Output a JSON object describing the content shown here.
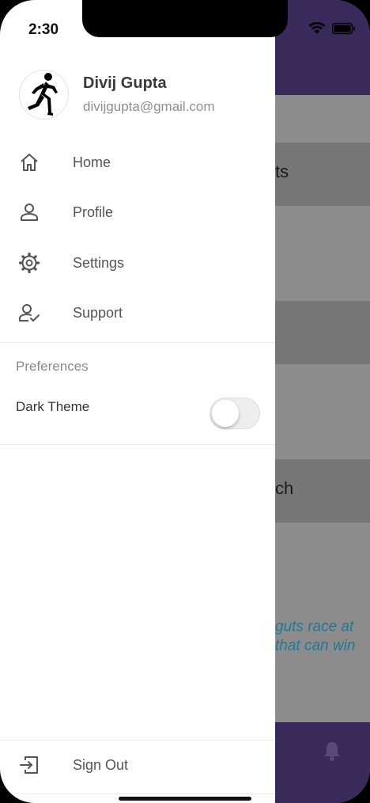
{
  "status_bar": {
    "time": "2:30"
  },
  "drawer": {
    "user": {
      "name": "Divij Gupta",
      "email": "divijgupta@gmail.com"
    },
    "nav_items": [
      {
        "label": "Home",
        "icon": "home-icon"
      },
      {
        "label": "Profile",
        "icon": "person-icon"
      },
      {
        "label": "Settings",
        "icon": "gear-icon"
      },
      {
        "label": "Support",
        "icon": "person-check-icon"
      }
    ],
    "preferences": {
      "title": "Preferences",
      "dark_theme_label": "Dark Theme",
      "dark_theme_on": false
    },
    "sign_out_label": "Sign Out"
  },
  "background_app": {
    "row_texts": [
      "ts",
      "ch"
    ],
    "quote_lines": [
      "guts race at",
      "that can win"
    ]
  },
  "colors": {
    "header": "#3a2a5c",
    "quote": "#1e7a96",
    "drawer_bg": "#ffffff",
    "text_primary": "#3a3a3a",
    "text_secondary": "#8e8e8e"
  }
}
